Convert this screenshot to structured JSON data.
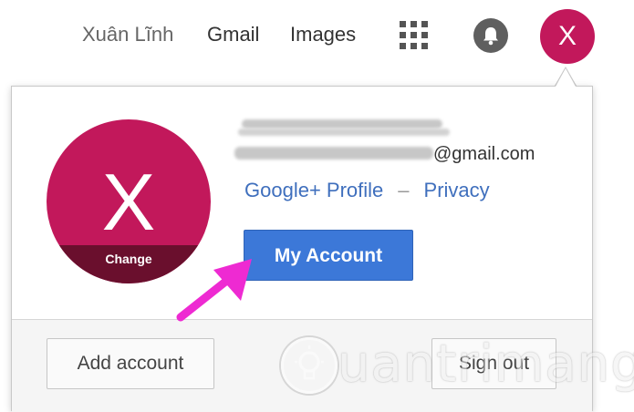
{
  "topbar": {
    "user_name": "Xuân Lĩnh",
    "gmail_label": "Gmail",
    "images_label": "Images",
    "avatar_letter": "X"
  },
  "account_popup": {
    "avatar_letter": "X",
    "change_label": "Change",
    "email_suffix": "@gmail.com",
    "profile_link": "Google+ Profile",
    "link_separator": "–",
    "privacy_link": "Privacy",
    "my_account_button": "My Account",
    "add_account_button": "Add account",
    "sign_out_button": "Sign out"
  },
  "watermark": {
    "text": "uantrimang"
  },
  "colors": {
    "avatar": "#c2185b",
    "avatar_change_band": "#6a0f2d",
    "primary_button": "#3c78d8",
    "link": "#3f6fbd",
    "annotation_arrow": "#ee2ad2"
  }
}
